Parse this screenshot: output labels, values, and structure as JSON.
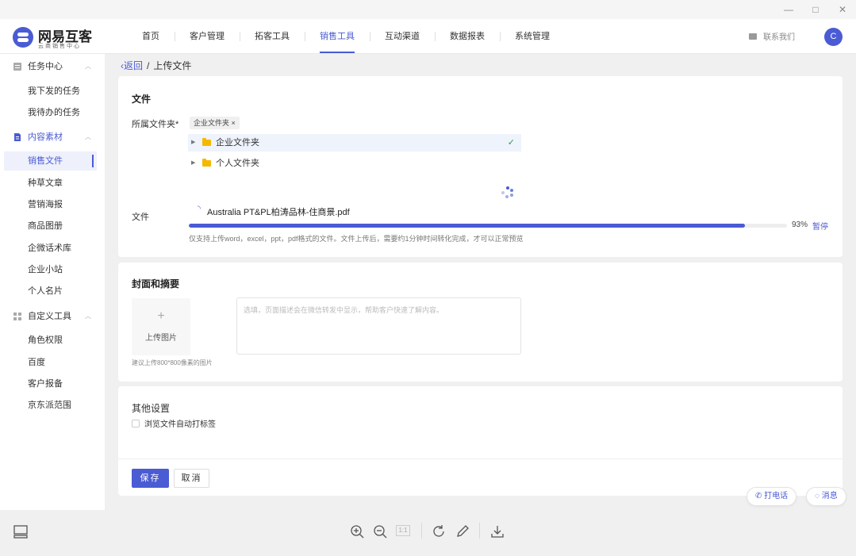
{
  "window": {
    "controls": {
      "minimize": "—",
      "maximize": "□",
      "close": "✕"
    }
  },
  "header": {
    "logo": {
      "title": "网易互客",
      "subtitle": "云商销售中心"
    },
    "nav": [
      {
        "label": "首页"
      },
      {
        "label": "客户管理"
      },
      {
        "label": "拓客工具"
      },
      {
        "label": "销售工具",
        "active": true
      },
      {
        "label": "互动渠道"
      },
      {
        "label": "数据报表"
      },
      {
        "label": "系统管理"
      }
    ],
    "contact_label": "联系我们",
    "avatar_letter": "C",
    "accent": "#4a5bd4"
  },
  "sidebar": {
    "groups": [
      {
        "label": "任务中心",
        "icon": "task-icon",
        "items": [
          "我下发的任务",
          "我待办的任务"
        ]
      },
      {
        "label": "内容素材",
        "icon": "document-icon",
        "active": true,
        "items": [
          "销售文件",
          "种草文章",
          "营销海报",
          "商品图册",
          "企微话术库",
          "企业小站",
          "个人名片"
        ]
      },
      {
        "label": "自定义工具",
        "icon": "grid-icon",
        "items": [
          "角色权限",
          "百度",
          "客户报备",
          "京东派范围"
        ]
      }
    ],
    "active_item": "销售文件"
  },
  "breadcrumb": {
    "back": "返回",
    "separator": "/",
    "current": "上传文件"
  },
  "file_section": {
    "title": "文件",
    "folder_label": "所属文件夹*",
    "selected_tag": "企业文件夹",
    "tag_close": "×",
    "tree": [
      {
        "label": "企业文件夹",
        "selected": true,
        "check": "✓"
      },
      {
        "label": "个人文件夹",
        "selected": false
      }
    ],
    "file_label": "文件",
    "filename": "Australia PT&PL柏涛品林-住商景.pdf",
    "progress_percent": 93,
    "progress_text": "93%",
    "pause_label": "暂停",
    "hint": "仅支持上传word，excel，ppt，pdf格式的文件。文件上传后，需要约1分钟时间转化完成，才可以正常预览"
  },
  "cover_section": {
    "title": "封面和摘要",
    "upload_plus": "+",
    "upload_label": "上传图片",
    "upload_hint": "建议上传800*800像素的图片",
    "summary_placeholder": "选填，页面描述会在微信转发中显示，帮助客户快速了解内容。"
  },
  "other_section": {
    "title": "其他设置",
    "checkbox_label": "浏览文件自动打标签",
    "checked": false
  },
  "actions": {
    "save": "保存",
    "cancel": "取消"
  },
  "floating": {
    "call": "打电话",
    "message": "消息"
  },
  "toolbar": {
    "icons": [
      "layout-icon",
      "zoom-in-icon",
      "zoom-out-icon",
      "actual-size-icon",
      "rotate-icon",
      "edit-icon",
      "download-icon"
    ],
    "actual_size_label": "1:1"
  }
}
